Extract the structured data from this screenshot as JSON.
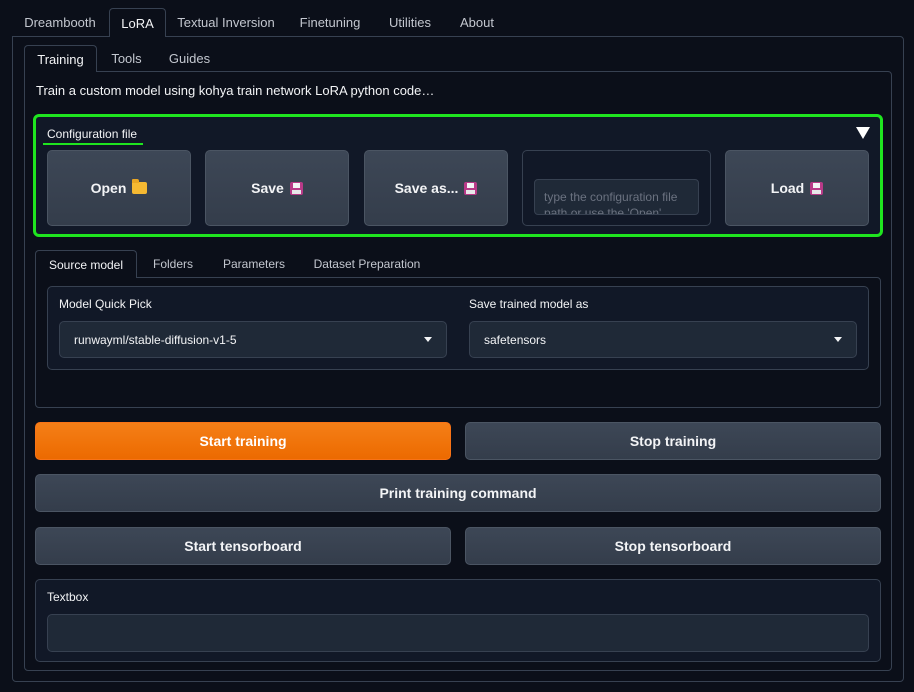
{
  "top_tabs": [
    "Dreambooth",
    "LoRA",
    "Textual Inversion",
    "Finetuning",
    "Utilities",
    "About"
  ],
  "top_active": "LoRA",
  "sub_tabs": [
    "Training",
    "Tools",
    "Guides"
  ],
  "sub_active": "Training",
  "description": "Train a custom model using kohya train network LoRA python code…",
  "config": {
    "label": "Configuration file",
    "open_label": "Open",
    "save_label": "Save",
    "save_as_label": "Save as...",
    "path_placeholder": "type the configuration file path or use the 'Open' button above to select it...",
    "load_label": "Load"
  },
  "section_tabs": [
    "Source model",
    "Folders",
    "Parameters",
    "Dataset Preparation"
  ],
  "section_active": "Source model",
  "source_model": {
    "quick_pick_label": "Model Quick Pick",
    "quick_pick_value": "runwayml/stable-diffusion-v1-5",
    "save_as_label": "Save trained model as",
    "save_as_value": "safetensors"
  },
  "actions": {
    "start_training": "Start training",
    "stop_training": "Stop training",
    "print_command": "Print training command",
    "start_tensorboard": "Start tensorboard",
    "stop_tensorboard": "Stop tensorboard"
  },
  "textbox": {
    "label": "Textbox",
    "value": ""
  },
  "colors": {
    "background": "#0b0f19",
    "highlight_border": "#1fe51f",
    "primary_button": "#f57f17",
    "secondary_button": "#374151"
  },
  "icons": {
    "open": "folder-icon",
    "save": "floppy-disk-icon",
    "save_as": "floppy-disk-icon",
    "load": "floppy-disk-icon",
    "collapse": "triangle-down-icon",
    "dropdown": "caret-down-icon"
  }
}
